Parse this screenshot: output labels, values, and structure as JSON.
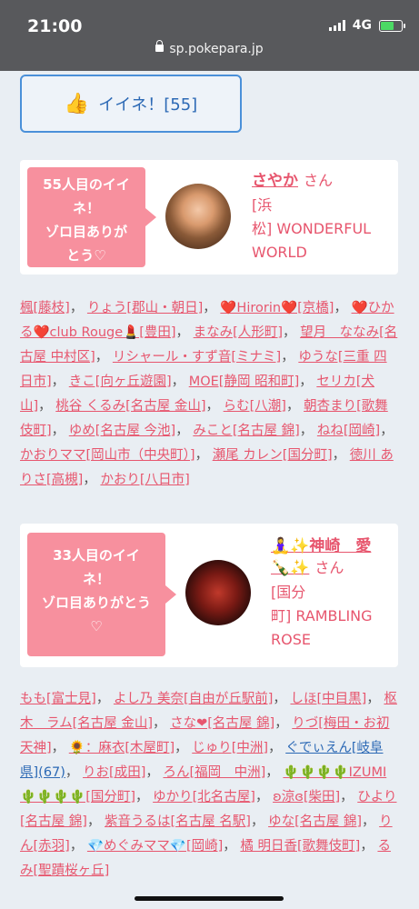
{
  "status": {
    "time": "21:00",
    "network": "4G"
  },
  "browser": {
    "url": "sp.pokepara.jp"
  },
  "like_button": {
    "icon": "thumbs-up-icon",
    "label": "イイネ！[55]"
  },
  "cards": [
    {
      "bubble_lines": [
        "55人目のイイ",
        "ネ！",
        "ゾロ目ありが",
        "とう♡"
      ],
      "name": "さやか",
      "honorific": "さん",
      "shop_lines": [
        "[浜",
        "松] WONDERFUL",
        "WORLD"
      ]
    },
    {
      "bubble_lines": [
        "33人目のイイ",
        "ネ！",
        "ゾロ目ありがとう",
        "♡"
      ],
      "name": "🧘‍♀️✨神崎　愛",
      "name_line2": "🍾✨",
      "honorific": "さん",
      "shop_lines": [
        "[国分",
        "町] RAMBLING",
        "ROSE"
      ]
    }
  ],
  "list1": [
    "楓[藤枝]",
    "りょう[郡山・朝日]",
    "❤️Hirorin❤️[京橋]",
    "❤️ひかる❤️club Rouge💄[豊田]",
    "まなみ[人形町]",
    "望月　ななみ[名古屋 中村区]",
    "リシャール・すず音[ミナミ]",
    "ゆうな[三重 四日市]",
    "きこ[向ヶ丘遊園]",
    "MOE[静岡 昭和町]",
    "セリカ[犬山]",
    "桃谷 くるみ[名古屋 金山]",
    "らむ[八潮]",
    "朝杏まり[歌舞伎町]",
    "ゆめ[名古屋 今池]",
    "みこと[名古屋 錦]",
    "ねね[岡崎]",
    "かおりママ[岡山市（中央町）]",
    "瀬尾 カレン[国分町]",
    "徳川 ありさ[高槻]",
    "かおり[八日市]"
  ],
  "list2": [
    "もも[富士見]",
    "よし乃 美奈[自由が丘駅前]",
    "しほ[中目黒]",
    "枢木　ラム[名古屋 金山]",
    "さな❤[名古屋 錦]",
    "りづ[梅田・お初天神]",
    "🌻：麻衣[木屋町]",
    "じゅり[中洲]",
    "ぐでぃえん[岐阜県](67)",
    "りお[成田]",
    "ろん[福岡　中洲]",
    "🌵🌵🌵🌵IZUMI🌵🌵🌵🌵[国分町]",
    "ゆかり[北名古屋]",
    "ʚ涼ɞ[柴田]",
    "ひより[名古屋 錦]",
    "紫音うるは[名古屋 名駅]",
    "ゆな[名古屋 錦]",
    "りん[赤羽]",
    "💎めぐみママ💎[岡崎]",
    "橘 明日香[歌舞伎町]",
    "るみ[聖蹟桜ヶ丘]"
  ],
  "colors": {
    "accent_pink": "#e7566e",
    "bubble_pink": "#f7909e",
    "link_blue": "#2c69b5"
  }
}
